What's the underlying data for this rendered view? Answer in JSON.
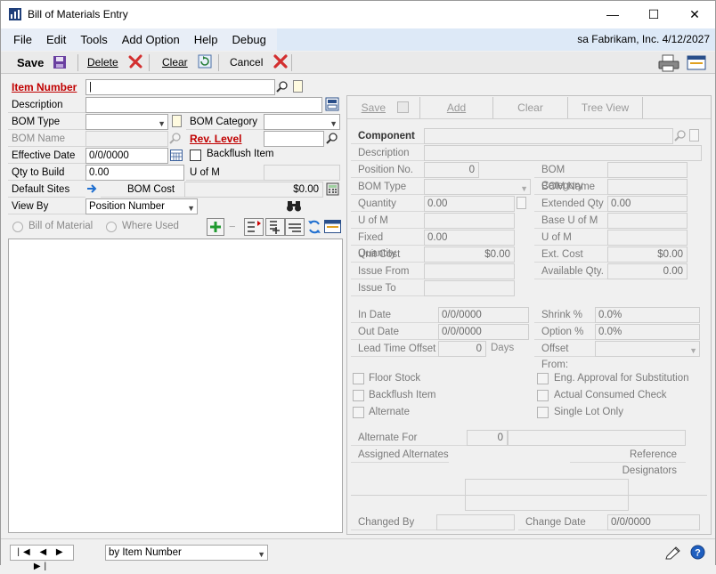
{
  "window": {
    "title": "Bill of Materials Entry",
    "minimize_glyph": "—",
    "maximize_glyph": "☐",
    "close_glyph": "✕"
  },
  "menu": {
    "items": [
      "File",
      "Edit",
      "Tools",
      "Add Option",
      "Help",
      "Debug"
    ],
    "status": "sa  Fabrikam, Inc.  4/12/2027"
  },
  "toolbar": {
    "save": "Save",
    "delete": "Delete",
    "clear": "Clear",
    "cancel": "Cancel"
  },
  "header": {
    "item_number_label": "Item Number",
    "item_number_value": "|",
    "description_label": "Description",
    "description_value": "",
    "bom_type_label": "BOM Type",
    "bom_type_value": "",
    "bom_category_label": "BOM Category",
    "bom_category_value": "",
    "bom_name_label": "BOM Name",
    "bom_name_value": "",
    "rev_level_label": "Rev. Level",
    "rev_level_value": "",
    "effective_date_label": "Effective Date",
    "effective_date_value": "0/0/0000",
    "backflush_label": "Backflush Item",
    "qty_to_build_label": "Qty to Build",
    "qty_to_build_value": "0.00",
    "u_of_m_label": "U of M",
    "u_of_m_value": "",
    "default_sites_label": "Default Sites",
    "bom_cost_label": "BOM Cost",
    "bom_cost_value": "$0.00",
    "view_by_label": "View By",
    "view_by_value": "Position Number",
    "radio_bill": "Bill of Material",
    "radio_where": "Where Used"
  },
  "panel": {
    "btn_save": "Save",
    "btn_add": "Add",
    "btn_clear": "Clear",
    "btn_tree": "Tree View",
    "component_label": "Component",
    "description_label": "Description",
    "position_no_label": "Position No.",
    "position_no_value": "0",
    "bom_category_label": "BOM Category",
    "bom_type_label": "BOM Type",
    "bom_name_label": "BOM Name",
    "quantity_label": "Quantity",
    "quantity_value": "0.00",
    "extended_qty_label": "Extended Qty",
    "extended_qty_value": "0.00",
    "uofm_label": "U of M",
    "base_uofm_label": "Base U of M",
    "fixed_qty_label": "Fixed Quantity",
    "fixed_qty_value": "0.00",
    "uofm2_label": "U of M",
    "unit_cost_label": "Unit Cost",
    "unit_cost_value": "$0.00",
    "ext_cost_label": "Ext. Cost",
    "ext_cost_value": "$0.00",
    "issue_from_label": "Issue From",
    "available_qty_label": "Available Qty.",
    "available_qty_value": "0.00",
    "issue_to_label": "Issue To",
    "in_date_label": "In Date",
    "in_date_value": "0/0/0000",
    "shrink_label": "Shrink %",
    "shrink_value": "0.0%",
    "out_date_label": "Out Date",
    "out_date_value": "0/0/0000",
    "option_label": "Option %",
    "option_value": "0.0%",
    "lead_time_label": "Lead Time Offset",
    "lead_time_value": "0",
    "days_label": "Days",
    "offset_from_label": "Offset From:",
    "floor_stock_label": "Floor Stock",
    "eng_approval_label": "Eng. Approval for Substitution",
    "backflush_label": "Backflush Item",
    "actual_consumed_label": "Actual Consumed Check",
    "alternate_label": "Alternate",
    "single_lot_label": "Single Lot Only",
    "alternate_for_label": "Alternate For",
    "alternate_for_value": "0",
    "assigned_alternates_label": "Assigned Alternates",
    "reference_designators_label": "Reference Designators",
    "changed_by_label": "Changed By",
    "change_date_label": "Change Date",
    "change_date_value": "0/0/0000"
  },
  "footer": {
    "nav": "|◀ ◀ ▶ ▶|",
    "sort_value": "by Item Number"
  },
  "colors": {
    "required_label": "#c00000",
    "menubar": "#dde9f7",
    "delete_x": "#d32f2f"
  }
}
